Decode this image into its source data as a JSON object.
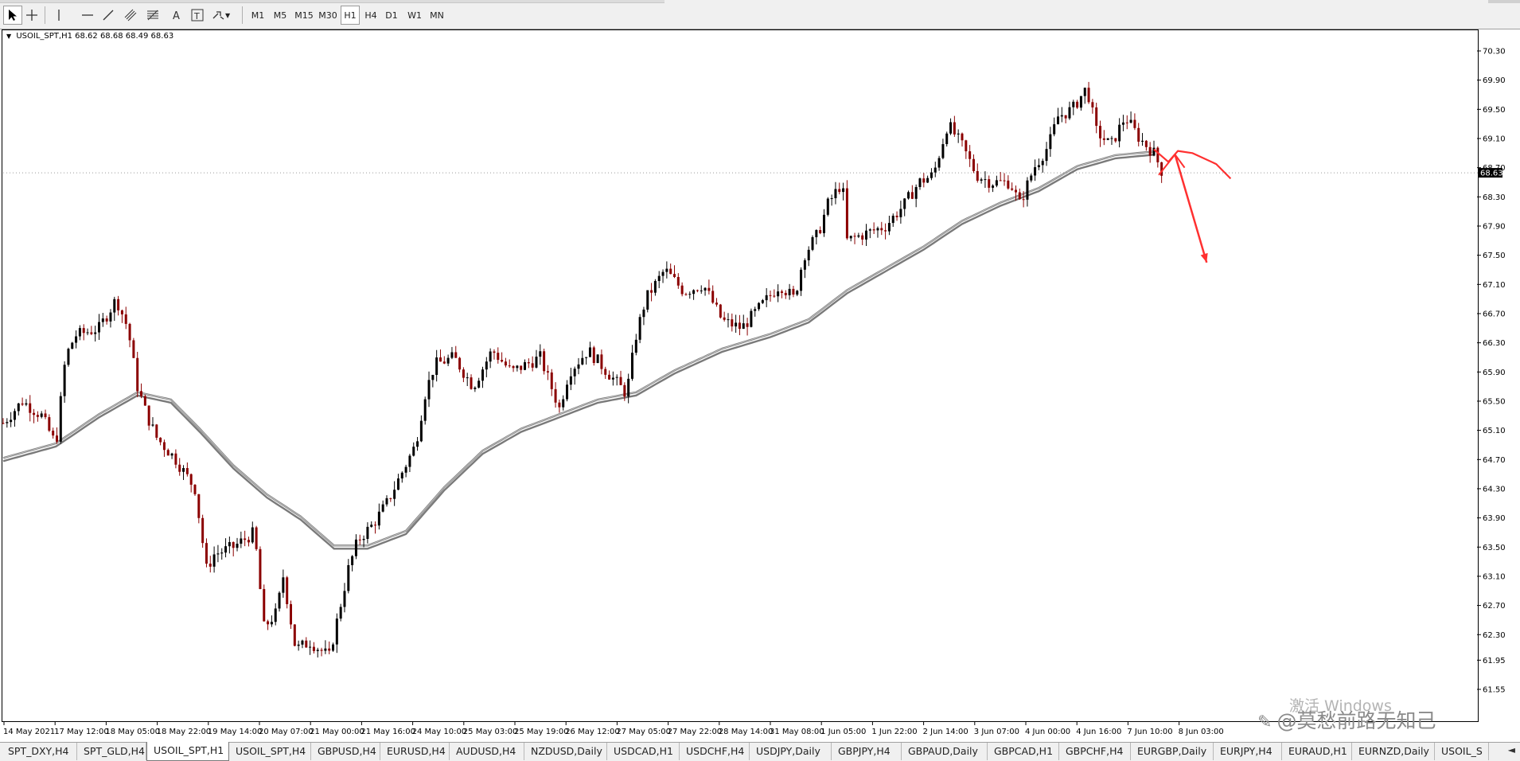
{
  "toolbar": {
    "timeframes": [
      "M1",
      "M5",
      "M15",
      "M30",
      "H1",
      "H4",
      "D1",
      "W1",
      "MN"
    ],
    "active_timeframe": "H1",
    "tools": [
      "cursor-icon",
      "crosshair-icon",
      "vertical-line-icon",
      "horizontal-line-icon",
      "trendline-icon",
      "equidistant-channel-icon",
      "fibonacci-icon",
      "text-icon",
      "text-label-icon",
      "arrow-shapes-icon"
    ]
  },
  "chart": {
    "symbol_info": "USOIL_SPT,H1",
    "ohlc": "68.62 68.68 68.49 68.63",
    "current_price": "68.63"
  },
  "chart_data": {
    "type": "candlestick",
    "price_axis_labels": [
      "70.30",
      "69.90",
      "69.50",
      "69.10",
      "68.70",
      "68.30",
      "67.90",
      "67.50",
      "67.10",
      "66.70",
      "66.30",
      "65.90",
      "65.50",
      "65.10",
      "64.70",
      "64.30",
      "63.90",
      "63.50",
      "63.10",
      "62.70",
      "62.30",
      "61.95",
      "61.55"
    ],
    "time_axis_labels": [
      "14 May 2021",
      "17 May 12:00",
      "18 May 05:00",
      "18 May 22:00",
      "19 May 14:00",
      "20 May 07:00",
      "21 May 00:00",
      "21 May 16:00",
      "24 May 10:00",
      "25 May 03:00",
      "25 May 19:00",
      "26 May 12:00",
      "27 May 05:00",
      "27 May 22:00",
      "28 May 14:00",
      "31 May 08:00",
      "1 Jun 05:00",
      "1 Jun 22:00",
      "2 Jun 14:00",
      "3 Jun 07:00",
      "4 Jun 00:00",
      "4 Jun 16:00",
      "7 Jun 10:00",
      "8 Jun 03:00"
    ],
    "ylim": [
      61.4,
      70.5
    ],
    "price_path": [
      [
        0,
        65.2
      ],
      [
        20,
        65.5
      ],
      [
        40,
        65.3
      ],
      [
        55,
        64.9
      ],
      [
        65,
        66.1
      ],
      [
        75,
        66.4
      ],
      [
        100,
        66.5
      ],
      [
        118,
        66.9
      ],
      [
        130,
        66.5
      ],
      [
        140,
        65.7
      ],
      [
        150,
        65.3
      ],
      [
        160,
        65.0
      ],
      [
        180,
        64.7
      ],
      [
        200,
        64.3
      ],
      [
        212,
        63.2
      ],
      [
        220,
        63.4
      ],
      [
        240,
        63.5
      ],
      [
        262,
        63.7
      ],
      [
        272,
        62.4
      ],
      [
        285,
        62.6
      ],
      [
        292,
        63.1
      ],
      [
        305,
        62.1
      ],
      [
        320,
        62.2
      ],
      [
        340,
        62.0
      ],
      [
        350,
        62.6
      ],
      [
        360,
        63.2
      ],
      [
        370,
        63.6
      ],
      [
        385,
        63.8
      ],
      [
        400,
        64.1
      ],
      [
        415,
        64.5
      ],
      [
        430,
        64.9
      ],
      [
        440,
        65.6
      ],
      [
        450,
        66.0
      ],
      [
        470,
        66.1
      ],
      [
        490,
        65.7
      ],
      [
        510,
        66.2
      ],
      [
        530,
        65.9
      ],
      [
        560,
        66.1
      ],
      [
        580,
        65.4
      ],
      [
        590,
        65.9
      ],
      [
        610,
        66.2
      ],
      [
        630,
        65.9
      ],
      [
        650,
        65.6
      ],
      [
        660,
        66.4
      ],
      [
        670,
        66.9
      ],
      [
        690,
        67.3
      ],
      [
        710,
        67.0
      ],
      [
        730,
        67.1
      ],
      [
        750,
        66.6
      ],
      [
        770,
        66.5
      ],
      [
        790,
        66.8
      ],
      [
        810,
        67.1
      ],
      [
        825,
        66.9
      ],
      [
        835,
        67.5
      ],
      [
        850,
        67.8
      ],
      [
        860,
        68.2
      ],
      [
        875,
        68.5
      ],
      [
        880,
        67.7
      ],
      [
        900,
        67.8
      ],
      [
        920,
        67.9
      ],
      [
        940,
        68.2
      ],
      [
        955,
        68.5
      ],
      [
        970,
        68.6
      ],
      [
        985,
        69.3
      ],
      [
        1000,
        69.0
      ],
      [
        1015,
        68.6
      ],
      [
        1030,
        68.5
      ],
      [
        1050,
        68.5
      ],
      [
        1060,
        68.2
      ],
      [
        1075,
        68.7
      ],
      [
        1090,
        69.0
      ],
      [
        1100,
        69.4
      ],
      [
        1115,
        69.5
      ],
      [
        1130,
        69.8
      ],
      [
        1140,
        69.2
      ],
      [
        1155,
        69.0
      ],
      [
        1170,
        69.4
      ],
      [
        1185,
        69.1
      ],
      [
        1200,
        68.9
      ],
      [
        1210,
        68.6
      ]
    ],
    "ma_path": [
      [
        0,
        64.7
      ],
      [
        55,
        64.9
      ],
      [
        100,
        65.3
      ],
      [
        140,
        65.6
      ],
      [
        175,
        65.5
      ],
      [
        205,
        65.1
      ],
      [
        240,
        64.6
      ],
      [
        275,
        64.2
      ],
      [
        310,
        63.9
      ],
      [
        345,
        63.5
      ],
      [
        380,
        63.5
      ],
      [
        420,
        63.7
      ],
      [
        460,
        64.3
      ],
      [
        500,
        64.8
      ],
      [
        540,
        65.1
      ],
      [
        580,
        65.3
      ],
      [
        620,
        65.5
      ],
      [
        660,
        65.6
      ],
      [
        700,
        65.9
      ],
      [
        750,
        66.2
      ],
      [
        800,
        66.4
      ],
      [
        840,
        66.6
      ],
      [
        880,
        67.0
      ],
      [
        920,
        67.3
      ],
      [
        960,
        67.6
      ],
      [
        1000,
        67.95
      ],
      [
        1040,
        68.2
      ],
      [
        1080,
        68.4
      ],
      [
        1120,
        68.7
      ],
      [
        1160,
        68.85
      ],
      [
        1200,
        68.9
      ]
    ],
    "annotations": [
      {
        "type": "arrow",
        "from": [
          1222,
          68.88
        ],
        "to": [
          1255,
          67.4
        ]
      },
      {
        "type": "curve",
        "points": [
          [
            1200,
            68.95
          ],
          [
            1215,
            68.78
          ],
          [
            1225,
            68.93
          ],
          [
            1240,
            68.9
          ],
          [
            1265,
            68.75
          ],
          [
            1280,
            68.55
          ]
        ]
      }
    ]
  },
  "tabs": [
    "SPT_DXY,H4",
    "SPT_GLD,H4",
    "USOIL_SPT,H1",
    "USOIL_SPT,H4",
    "GBPUSD,H4",
    "EURUSD,H4",
    "AUDUSD,H4",
    "NZDUSD,Daily",
    "USDCAD,H1",
    "USDCHF,H4",
    "USDJPY,Daily",
    "GBPJPY,H4",
    "GBPAUD,Daily",
    "GBPCAD,H1",
    "GBPCHF,H4",
    "EURGBP,Daily",
    "EURJPY,H4",
    "EURAUD,H1",
    "EURNZD,Daily",
    "USOIL_S"
  ],
  "active_tab": "USOIL_SPT,H1",
  "tab_scroll": "◄",
  "watermark": {
    "activation": "激活 Windows",
    "user": "@莫愁前路无知己"
  },
  "colors": {
    "candle_up": "#000000",
    "candle_down": "#8b0000",
    "ma": "#7a7a7a",
    "annotation": "#ff3030",
    "price_badge_bg": "#000000"
  }
}
